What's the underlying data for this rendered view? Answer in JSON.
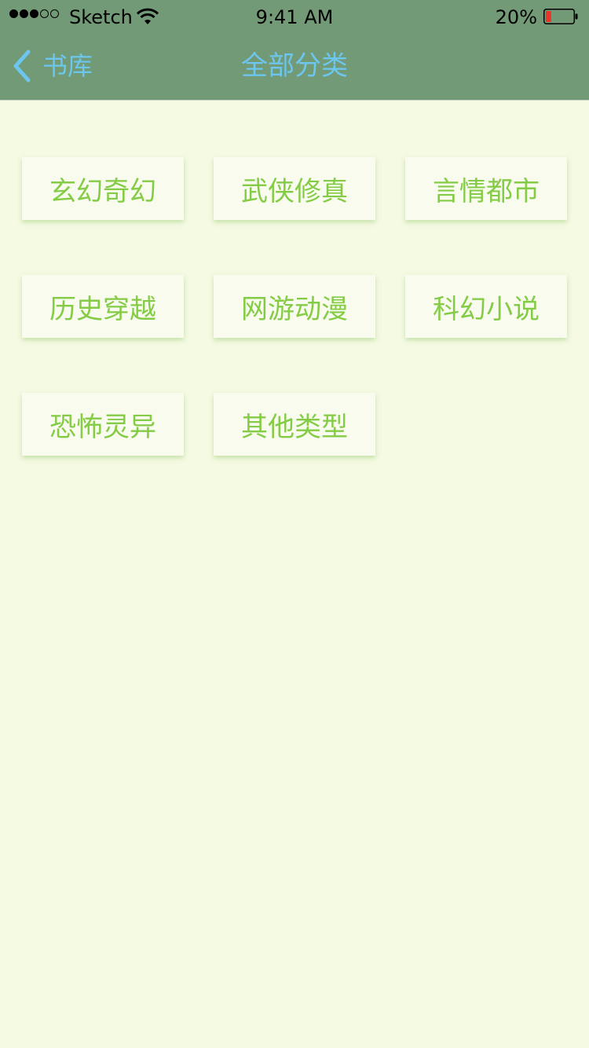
{
  "status_bar": {
    "carrier": "Sketch",
    "time": "9:41 AM",
    "battery_percent": "20%",
    "battery_level": 0.2,
    "signal_bars": 3,
    "signal_total": 5
  },
  "nav": {
    "back_label": "书库",
    "title": "全部分类",
    "back_icon": "chevron-left-icon"
  },
  "categories": [
    "玄幻奇幻",
    "武侠修真",
    "言情都市",
    "历史穿越",
    "网游动漫",
    "科幻小说",
    "恐怖灵异",
    "其他类型"
  ],
  "colors": {
    "header_bg": "#729a77",
    "page_bg": "#f5fae3",
    "nav_text": "#6cc6ee",
    "category_text": "#84cc45",
    "battery_low": "#e8342b"
  }
}
